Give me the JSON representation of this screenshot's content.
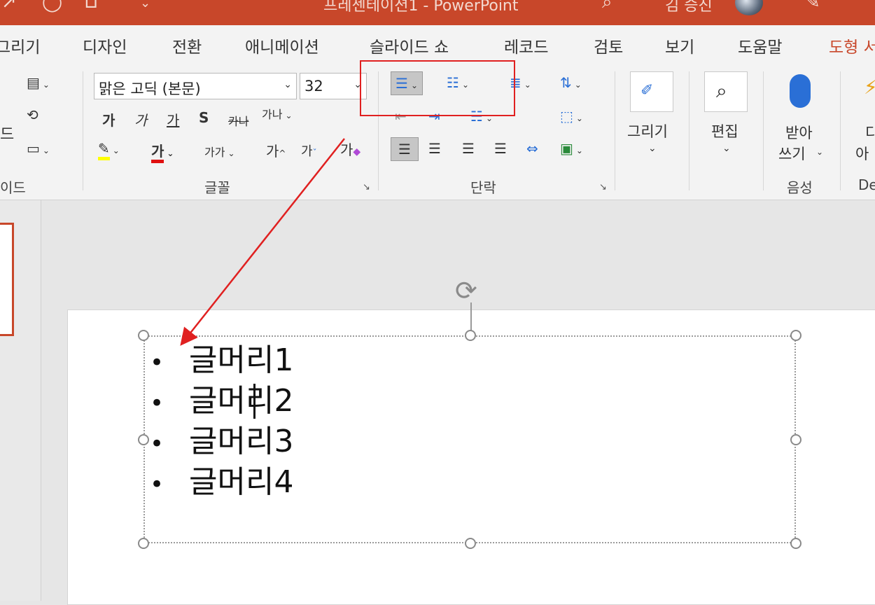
{
  "titlebar": {
    "title": "프레젠테이션1 - PowerPoint",
    "user": "김 승진"
  },
  "tabs": [
    "그리기",
    "디자인",
    "전환",
    "애니메이션",
    "슬라이드 쇼",
    "레코드",
    "검토",
    "보기",
    "도움말",
    "도형 서"
  ],
  "active_tab": "도형 서",
  "font": {
    "name": "맑은 고딕 (본문)",
    "size": "32",
    "bold": "가",
    "italic": "가",
    "underline": "가",
    "shadow": "S",
    "strike": "카나",
    "spacing": "가나",
    "case": "가가",
    "grow": "가",
    "shrink": "가",
    "clear": "가",
    "color": "가",
    "group_label": "글꼴"
  },
  "slide_group": {
    "partial_label": "드",
    "group_label": "이드"
  },
  "paragraph": {
    "group_label": "단락"
  },
  "draw": {
    "label": "그리기"
  },
  "edit": {
    "label": "편집"
  },
  "voice": {
    "line1": "받아",
    "line2": "쓰기",
    "group_label": "음성"
  },
  "designer": {
    "partial1": "디",
    "partial2": "아",
    "group_label": "De"
  },
  "slide": {
    "bullets": [
      "글머리1",
      "글머리2",
      "글머리3",
      "글머리4"
    ]
  },
  "accent": {
    "brand": "#c8472a",
    "highlight_box": "#e02020"
  }
}
